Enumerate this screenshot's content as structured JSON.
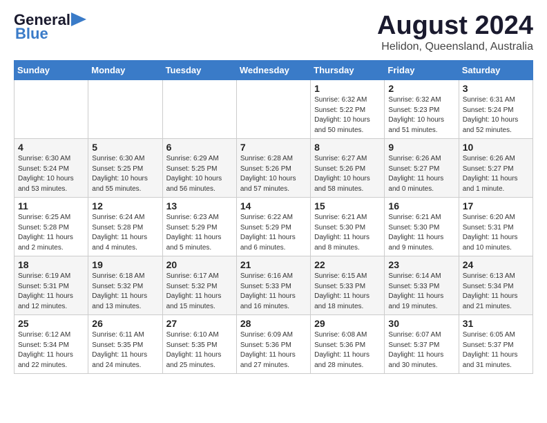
{
  "header": {
    "logo_text_general": "General",
    "logo_text_blue": "Blue",
    "month": "August 2024",
    "location": "Helidon, Queensland, Australia"
  },
  "weekdays": [
    "Sunday",
    "Monday",
    "Tuesday",
    "Wednesday",
    "Thursday",
    "Friday",
    "Saturday"
  ],
  "weeks": [
    [
      {
        "day": "",
        "info": ""
      },
      {
        "day": "",
        "info": ""
      },
      {
        "day": "",
        "info": ""
      },
      {
        "day": "",
        "info": ""
      },
      {
        "day": "1",
        "info": "Sunrise: 6:32 AM\nSunset: 5:22 PM\nDaylight: 10 hours\nand 50 minutes."
      },
      {
        "day": "2",
        "info": "Sunrise: 6:32 AM\nSunset: 5:23 PM\nDaylight: 10 hours\nand 51 minutes."
      },
      {
        "day": "3",
        "info": "Sunrise: 6:31 AM\nSunset: 5:24 PM\nDaylight: 10 hours\nand 52 minutes."
      }
    ],
    [
      {
        "day": "4",
        "info": "Sunrise: 6:30 AM\nSunset: 5:24 PM\nDaylight: 10 hours\nand 53 minutes."
      },
      {
        "day": "5",
        "info": "Sunrise: 6:30 AM\nSunset: 5:25 PM\nDaylight: 10 hours\nand 55 minutes."
      },
      {
        "day": "6",
        "info": "Sunrise: 6:29 AM\nSunset: 5:25 PM\nDaylight: 10 hours\nand 56 minutes."
      },
      {
        "day": "7",
        "info": "Sunrise: 6:28 AM\nSunset: 5:26 PM\nDaylight: 10 hours\nand 57 minutes."
      },
      {
        "day": "8",
        "info": "Sunrise: 6:27 AM\nSunset: 5:26 PM\nDaylight: 10 hours\nand 58 minutes."
      },
      {
        "day": "9",
        "info": "Sunrise: 6:26 AM\nSunset: 5:27 PM\nDaylight: 11 hours\nand 0 minutes."
      },
      {
        "day": "10",
        "info": "Sunrise: 6:26 AM\nSunset: 5:27 PM\nDaylight: 11 hours\nand 1 minute."
      }
    ],
    [
      {
        "day": "11",
        "info": "Sunrise: 6:25 AM\nSunset: 5:28 PM\nDaylight: 11 hours\nand 2 minutes."
      },
      {
        "day": "12",
        "info": "Sunrise: 6:24 AM\nSunset: 5:28 PM\nDaylight: 11 hours\nand 4 minutes."
      },
      {
        "day": "13",
        "info": "Sunrise: 6:23 AM\nSunset: 5:29 PM\nDaylight: 11 hours\nand 5 minutes."
      },
      {
        "day": "14",
        "info": "Sunrise: 6:22 AM\nSunset: 5:29 PM\nDaylight: 11 hours\nand 6 minutes."
      },
      {
        "day": "15",
        "info": "Sunrise: 6:21 AM\nSunset: 5:30 PM\nDaylight: 11 hours\nand 8 minutes."
      },
      {
        "day": "16",
        "info": "Sunrise: 6:21 AM\nSunset: 5:30 PM\nDaylight: 11 hours\nand 9 minutes."
      },
      {
        "day": "17",
        "info": "Sunrise: 6:20 AM\nSunset: 5:31 PM\nDaylight: 11 hours\nand 10 minutes."
      }
    ],
    [
      {
        "day": "18",
        "info": "Sunrise: 6:19 AM\nSunset: 5:31 PM\nDaylight: 11 hours\nand 12 minutes."
      },
      {
        "day": "19",
        "info": "Sunrise: 6:18 AM\nSunset: 5:32 PM\nDaylight: 11 hours\nand 13 minutes."
      },
      {
        "day": "20",
        "info": "Sunrise: 6:17 AM\nSunset: 5:32 PM\nDaylight: 11 hours\nand 15 minutes."
      },
      {
        "day": "21",
        "info": "Sunrise: 6:16 AM\nSunset: 5:33 PM\nDaylight: 11 hours\nand 16 minutes."
      },
      {
        "day": "22",
        "info": "Sunrise: 6:15 AM\nSunset: 5:33 PM\nDaylight: 11 hours\nand 18 minutes."
      },
      {
        "day": "23",
        "info": "Sunrise: 6:14 AM\nSunset: 5:33 PM\nDaylight: 11 hours\nand 19 minutes."
      },
      {
        "day": "24",
        "info": "Sunrise: 6:13 AM\nSunset: 5:34 PM\nDaylight: 11 hours\nand 21 minutes."
      }
    ],
    [
      {
        "day": "25",
        "info": "Sunrise: 6:12 AM\nSunset: 5:34 PM\nDaylight: 11 hours\nand 22 minutes."
      },
      {
        "day": "26",
        "info": "Sunrise: 6:11 AM\nSunset: 5:35 PM\nDaylight: 11 hours\nand 24 minutes."
      },
      {
        "day": "27",
        "info": "Sunrise: 6:10 AM\nSunset: 5:35 PM\nDaylight: 11 hours\nand 25 minutes."
      },
      {
        "day": "28",
        "info": "Sunrise: 6:09 AM\nSunset: 5:36 PM\nDaylight: 11 hours\nand 27 minutes."
      },
      {
        "day": "29",
        "info": "Sunrise: 6:08 AM\nSunset: 5:36 PM\nDaylight: 11 hours\nand 28 minutes."
      },
      {
        "day": "30",
        "info": "Sunrise: 6:07 AM\nSunset: 5:37 PM\nDaylight: 11 hours\nand 30 minutes."
      },
      {
        "day": "31",
        "info": "Sunrise: 6:05 AM\nSunset: 5:37 PM\nDaylight: 11 hours\nand 31 minutes."
      }
    ]
  ]
}
